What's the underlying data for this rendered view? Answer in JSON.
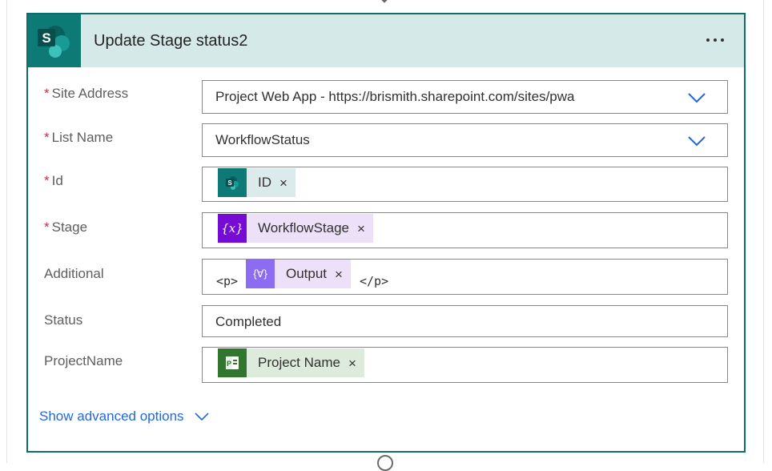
{
  "card": {
    "title": "Update Stage status2",
    "more_label": "...",
    "header_color": "#d6e9e9",
    "border_color": "#0e6c69"
  },
  "fields": {
    "site_address": {
      "label": "Site Address",
      "required": "*",
      "value": "Project Web App - https://brismith.sharepoint.com/sites/pwa"
    },
    "list_name": {
      "label": "List Name",
      "required": "*",
      "value": "WorkflowStatus"
    },
    "id": {
      "label": "Id",
      "required": "*",
      "token": {
        "icon": "sharepoint-icon",
        "label": "ID",
        "remove": "×",
        "bg": "#dbeaea"
      }
    },
    "stage": {
      "label": "Stage",
      "required": "*",
      "token": {
        "icon": "variable-icon",
        "icon_text": "{x}",
        "label": "WorkflowStage",
        "remove": "×",
        "bg": "#ece1f8"
      }
    },
    "additional": {
      "label": "Additional",
      "prefix": "<p>",
      "suffix": "</p>",
      "token": {
        "icon": "compose-icon",
        "icon_text": "{∀}",
        "label": "Output",
        "remove": "×",
        "bg": "#ece1f8"
      }
    },
    "status": {
      "label": "Status",
      "value": "Completed"
    },
    "project_name": {
      "label": "ProjectName",
      "token": {
        "icon": "project-icon",
        "label": "Project Name",
        "remove": "×",
        "bg": "#dcebdc"
      }
    }
  },
  "advanced": {
    "label": "Show advanced options"
  },
  "colors": {
    "link": "#2266e3",
    "required": "#c4314b",
    "sharepoint_teal": "#0e7a76",
    "variable_purple": "#770bd6",
    "compose_purple": "#8c6cf0",
    "project_green": "#31752f"
  }
}
